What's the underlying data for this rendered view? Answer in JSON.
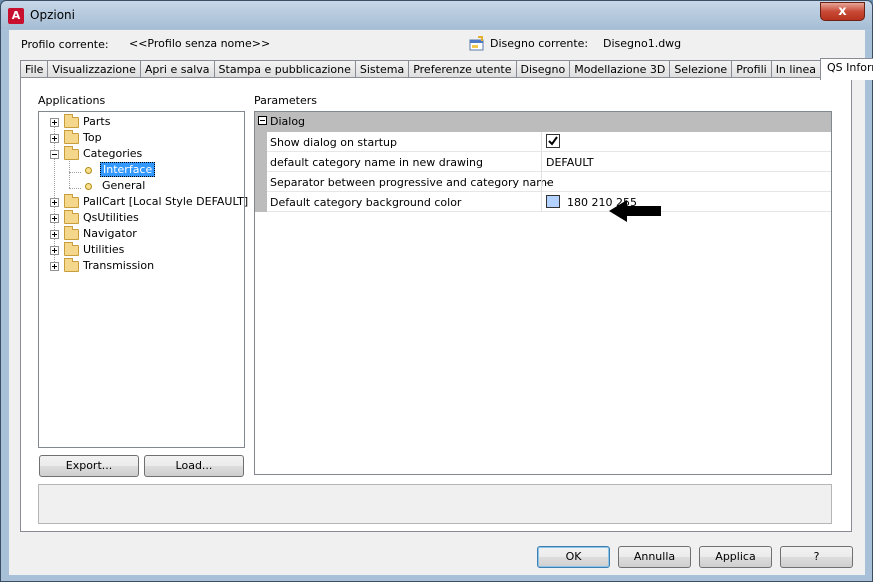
{
  "window": {
    "title": "Opzioni",
    "app_icon_letter": "A",
    "close_symbol": "x"
  },
  "header": {
    "profile_label": "Profilo corrente:",
    "profile_value": "<<Profilo senza nome>>",
    "drawing_label": "Disegno corrente:",
    "drawing_value": "Disegno1.dwg"
  },
  "tabs": [
    {
      "label": "File"
    },
    {
      "label": "Visualizzazione"
    },
    {
      "label": "Apri e salva"
    },
    {
      "label": "Stampa e pubblicazione"
    },
    {
      "label": "Sistema"
    },
    {
      "label": "Preferenze utente"
    },
    {
      "label": "Disegno"
    },
    {
      "label": "Modellazione 3D"
    },
    {
      "label": "Selezione"
    },
    {
      "label": "Profili"
    },
    {
      "label": "In linea"
    },
    {
      "label": "QS Informatica",
      "active": true
    }
  ],
  "applications": {
    "label": "Applications",
    "items": [
      {
        "label": "Parts"
      },
      {
        "label": "Top"
      },
      {
        "label": "Categories"
      },
      {
        "label": "Interface"
      },
      {
        "label": "General"
      },
      {
        "label": "PallCart [Local Style DEFAULT]"
      },
      {
        "label": "QsUtilities"
      },
      {
        "label": "Navigator"
      },
      {
        "label": "Utilities"
      },
      {
        "label": "Transmission"
      }
    ],
    "export_label": "Export...",
    "load_label": "Load..."
  },
  "parameters": {
    "label": "Parameters",
    "group": "Dialog",
    "rows": [
      {
        "name": "Show dialog on startup",
        "value": "",
        "checked": true
      },
      {
        "name": "default category name in new drawing",
        "value": "DEFAULT"
      },
      {
        "name": "Separator between progressive and category name",
        "value": "-"
      },
      {
        "name": "Default category background color",
        "value": "180 210 255",
        "swatch": "#b4d2ff"
      }
    ]
  },
  "footer": {
    "ok": "OK",
    "cancel": "Annulla",
    "apply": "Applica",
    "help": "?"
  },
  "colors": {
    "selection": "#3399ff",
    "accent_close": "#c74a36"
  }
}
